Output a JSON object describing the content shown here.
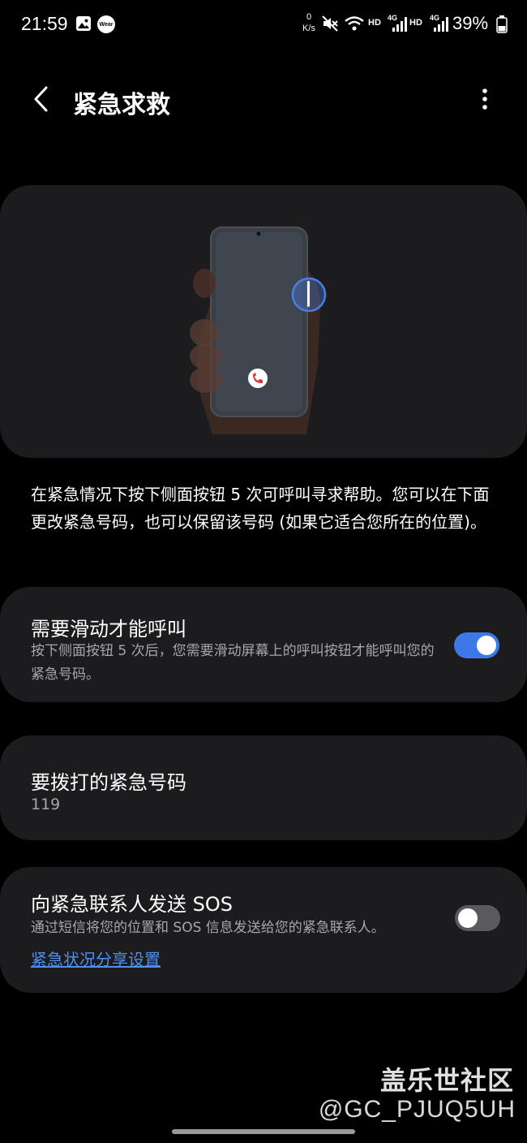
{
  "status_bar": {
    "time": "21:59",
    "net_speed_value": "0",
    "net_speed_unit": "K/s",
    "hd_label_1": "HD",
    "hd_label_2": "HD",
    "network_label_1": "4G",
    "network_label_2": "4G",
    "battery_percent": "39%",
    "icons": [
      "gallery-icon",
      "wear-icon",
      "mute-icon",
      "wifi-icon",
      "signal-icon",
      "signal-icon",
      "battery-icon"
    ],
    "wear_label": "Wear"
  },
  "app_bar": {
    "title": "紧急求救",
    "back_icon": "chevron-left-icon",
    "more_icon": "more-vertical-icon"
  },
  "description": "在紧急情况下按下侧面按钮 5 次可呼叫寻求帮助。您可以在下面更改紧急号码，也可以保留该号码 (如果它适合您所在的位置)。",
  "swipe_to_call": {
    "title": "需要滑动才能呼叫",
    "subtitle": "按下侧面按钮 5 次后，您需要滑动屏幕上的呼叫按钮才能呼叫您的紧急号码。",
    "enabled": true
  },
  "emergency_number": {
    "title": "要拨打的紧急号码",
    "value": "119"
  },
  "send_sos": {
    "title": "向紧急联系人发送 SOS",
    "subtitle": "通过短信将您的位置和 SOS 信息发送给您的紧急联系人。",
    "link": "紧急状况分享设置",
    "enabled": false
  },
  "watermark": {
    "line1": "盖乐世社区",
    "line2": "@GC_PJUQ5UH"
  },
  "colors": {
    "background": "#000000",
    "card": "#1c1c1e",
    "accent": "#3e78e8",
    "link": "#4d8ff0",
    "secondary_text": "#a7a7ab"
  }
}
